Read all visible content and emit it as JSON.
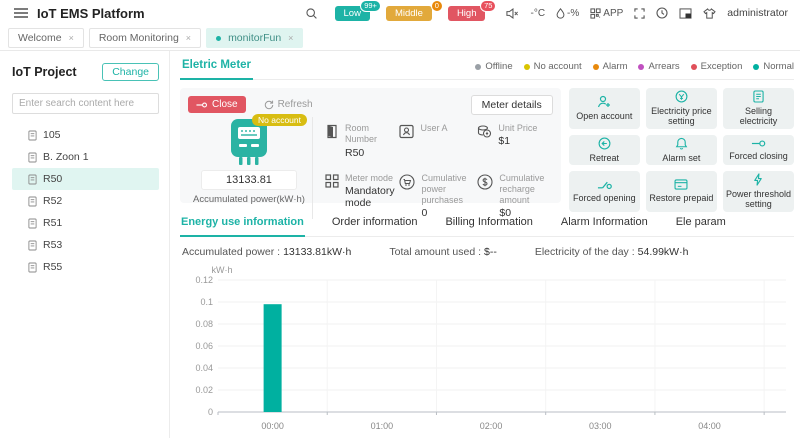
{
  "colors": {
    "primary": "#1db3a6",
    "close_red": "#e15662",
    "badge_yellow": "#d8bd12",
    "selected_row": "#e0f5f1"
  },
  "header": {
    "title": "IoT EMS Platform",
    "alarm_levels": [
      {
        "label": "Low",
        "count": "99+",
        "color": "#1db3a6",
        "count_color": "#1db3a6"
      },
      {
        "label": "Middle",
        "count": "0",
        "color": "#e2a93b",
        "count_color": "#e8890c"
      },
      {
        "label": "High",
        "count": "75",
        "color": "#e15662",
        "count_color": "#e8505c"
      }
    ],
    "temperature": "-°C",
    "humidity": "-%",
    "app_label": "APP",
    "user": "administrator"
  },
  "tabs": [
    {
      "label": "Welcome"
    },
    {
      "label": "Room Monitoring"
    },
    {
      "label": "monitorFun",
      "active": true
    }
  ],
  "sidebar": {
    "title": "IoT Project",
    "change_button": "Change",
    "search_placeholder": "Enter search content here",
    "items": [
      {
        "label": "105"
      },
      {
        "label": "B. Zoon 1"
      },
      {
        "label": "R50",
        "selected": true
      },
      {
        "label": "R52"
      },
      {
        "label": "R51"
      },
      {
        "label": "R53"
      },
      {
        "label": "R55"
      }
    ]
  },
  "main": {
    "section_tab": "Eletric Meter",
    "legend": [
      {
        "label": "Offline",
        "color": "#9aa0a6"
      },
      {
        "label": "No account",
        "color": "#d9c400"
      },
      {
        "label": "Alarm",
        "color": "#e8890c"
      },
      {
        "label": "Arrears",
        "color": "#c050c0"
      },
      {
        "label": "Exception",
        "color": "#e0505a"
      },
      {
        "label": "Normal",
        "color": "#00b0a0"
      }
    ],
    "meter": {
      "close_button": "Close",
      "refresh_button": "Refresh",
      "details_button": "Meter details",
      "status_badge": "No account",
      "accumulated_value": "13133.81",
      "accumulated_label": "Accumulated power(kW·h)",
      "fields": [
        {
          "label": "Room Number",
          "value": "R50"
        },
        {
          "label": "User A",
          "value": ""
        },
        {
          "label": "Unit Price",
          "value": "$1"
        },
        {
          "label": "Meter mode",
          "value": "Mandatory mode"
        },
        {
          "label": "Cumulative power purchases",
          "value": "0"
        },
        {
          "label": "Cumulative recharge amount",
          "value": "$0"
        }
      ]
    },
    "actions": [
      "Open account",
      "Electricity price setting",
      "Selling electricity",
      "Retreat",
      "Alarm set",
      "Forced closing",
      "Forced opening",
      "Restore prepaid",
      "Power threshold setting"
    ],
    "info_tabs": [
      {
        "label": "Energy use information",
        "active": true
      },
      {
        "label": "Order information"
      },
      {
        "label": "Billing Information"
      },
      {
        "label": "Alarm Information"
      },
      {
        "label": "Ele param"
      }
    ],
    "summary": [
      {
        "label": "Accumulated power :",
        "value": "13133.81kW·h"
      },
      {
        "label": "Total amount used :",
        "value": "$--"
      },
      {
        "label": "Electricity of the day :",
        "value": "54.99kW·h"
      }
    ]
  },
  "chart_data": {
    "type": "bar",
    "title": "",
    "xlabel": "",
    "ylabel": "kW·h",
    "categories": [
      "00:00",
      "01:00",
      "02:00",
      "03:00",
      "04:00"
    ],
    "values": [
      0.098,
      0,
      0,
      0,
      0
    ],
    "ylim": [
      0,
      0.12
    ],
    "ytick_step": 0.02,
    "bar_color": "#00b0a0",
    "grid": true,
    "legend_position": "none"
  }
}
